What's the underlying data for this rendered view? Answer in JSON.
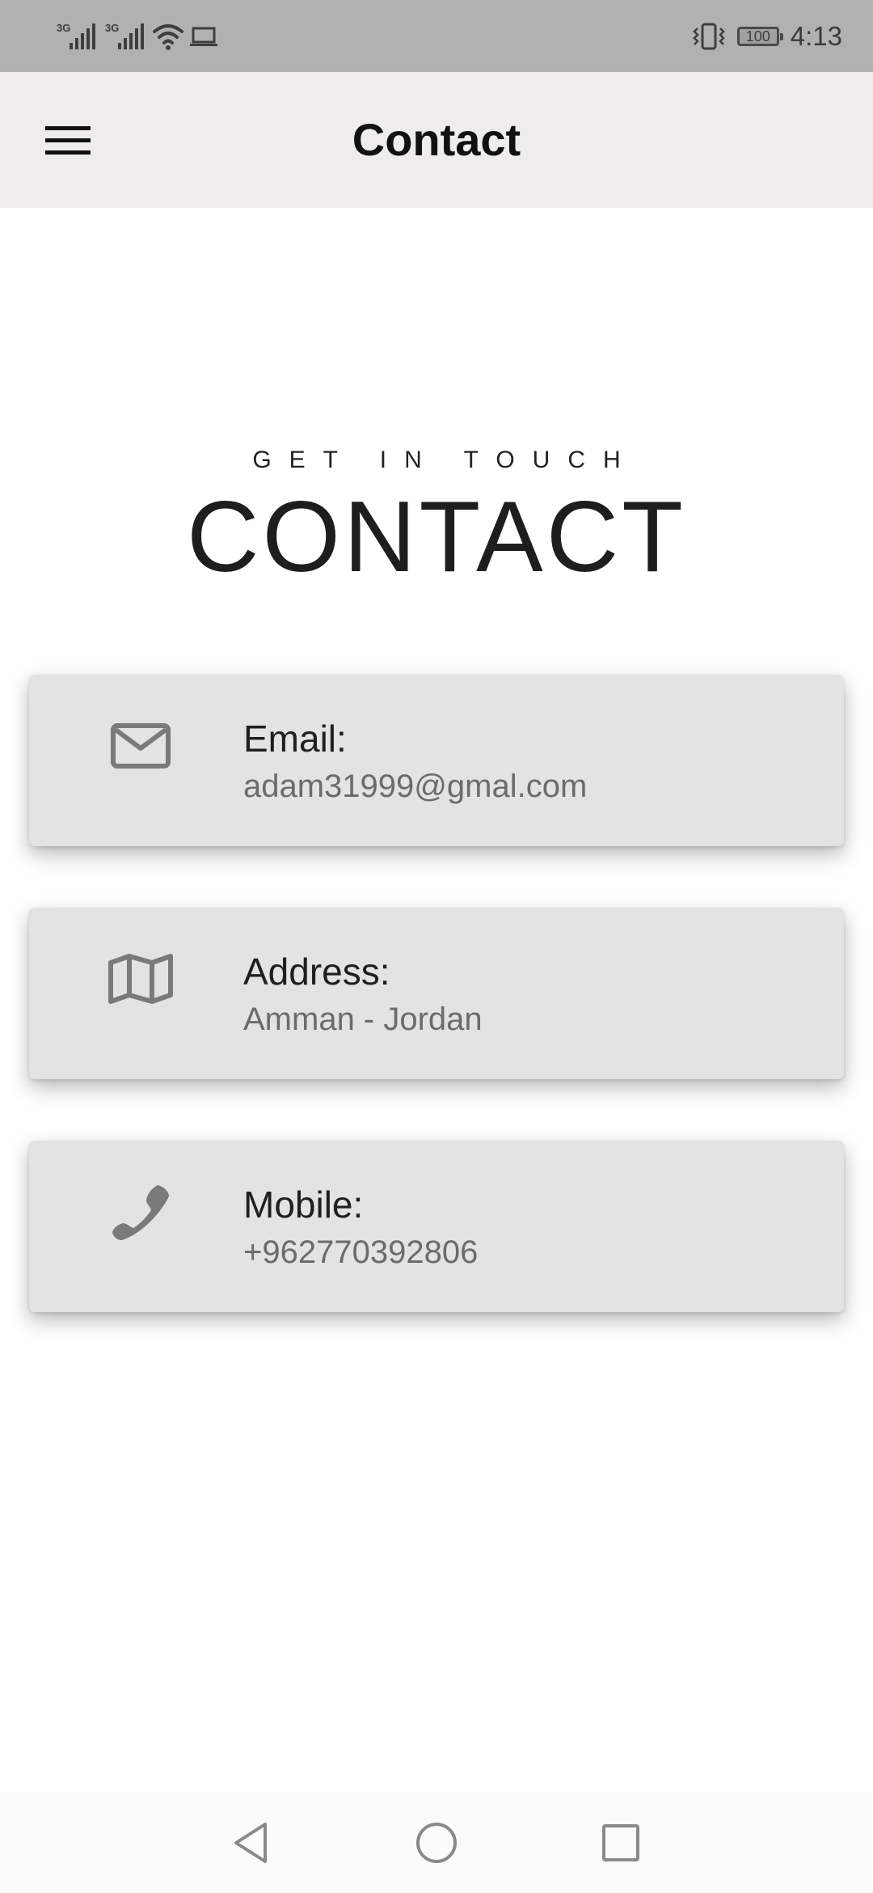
{
  "status_bar": {
    "signal1_label": "3G",
    "signal2_label": "3G",
    "battery": "100",
    "time": "4:13"
  },
  "app_bar": {
    "title": "Contact"
  },
  "header": {
    "eyebrow": "GET IN TOUCH",
    "heading": "CONTACT"
  },
  "cards": [
    {
      "icon": "envelope-icon",
      "label": "Email:",
      "value": "adam31999@gmal.com"
    },
    {
      "icon": "map-icon",
      "label": "Address:",
      "value": "Amman - Jordan"
    },
    {
      "icon": "phone-icon",
      "label": "Mobile:",
      "value": "+962770392806"
    }
  ],
  "colors": {
    "status_bar_bg": "#b2b1b2",
    "app_bar_bg": "#efeced",
    "card_bg": "#e3e3e3",
    "icon_color": "#7a7a7a"
  }
}
